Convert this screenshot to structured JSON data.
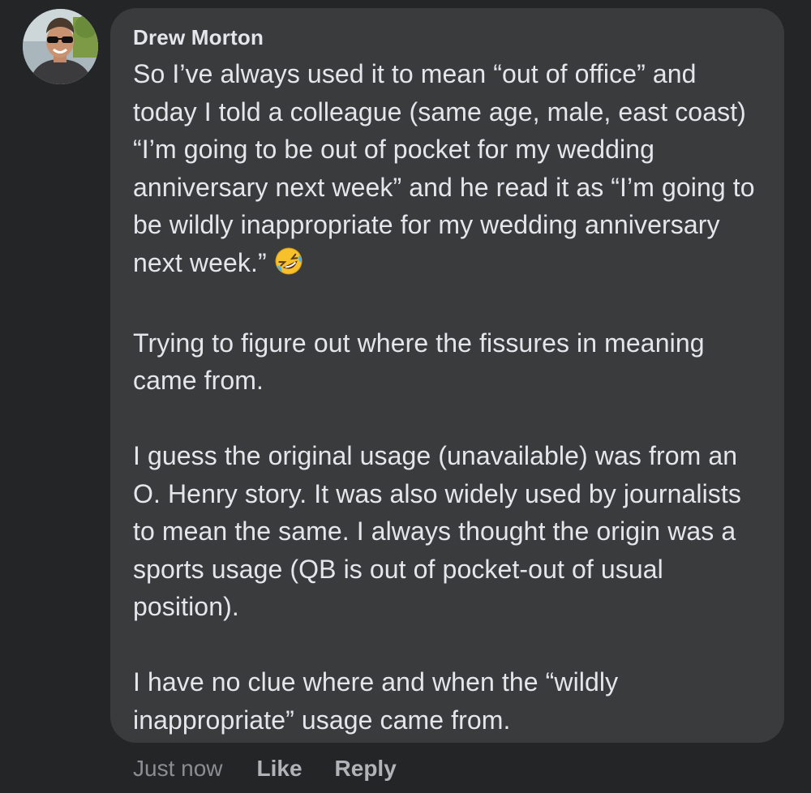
{
  "comment": {
    "author": "Drew Morton",
    "paragraphs": [
      "So I’ve always used it to mean “out of office” and today I told a colleague (same age, male, east coast) “I’m going to be out of pocket for my wedding anniversary next week” and he read it as “I’m going to be wildly inappropriate for my wedding anniversary next week.”",
      "Trying to figure out where the fissures in meaning came from.",
      "I guess the original usage (unavailable) was from an O. Henry story.  It was also widely used by journalists to mean the same.  I always thought the origin was a sports usage (QB is out of pocket-out of usual position).",
      "I have no clue where and when the “wildly inappropriate” usage came from."
    ],
    "emoji": "rolling-on-the-floor-laughing-emoji",
    "timestamp": "Just now",
    "like_label": "Like",
    "reply_label": "Reply"
  },
  "colors": {
    "background": "#242526",
    "bubble": "#3a3b3c",
    "text": "#e4e6eb",
    "muted": "#8a8d91"
  }
}
